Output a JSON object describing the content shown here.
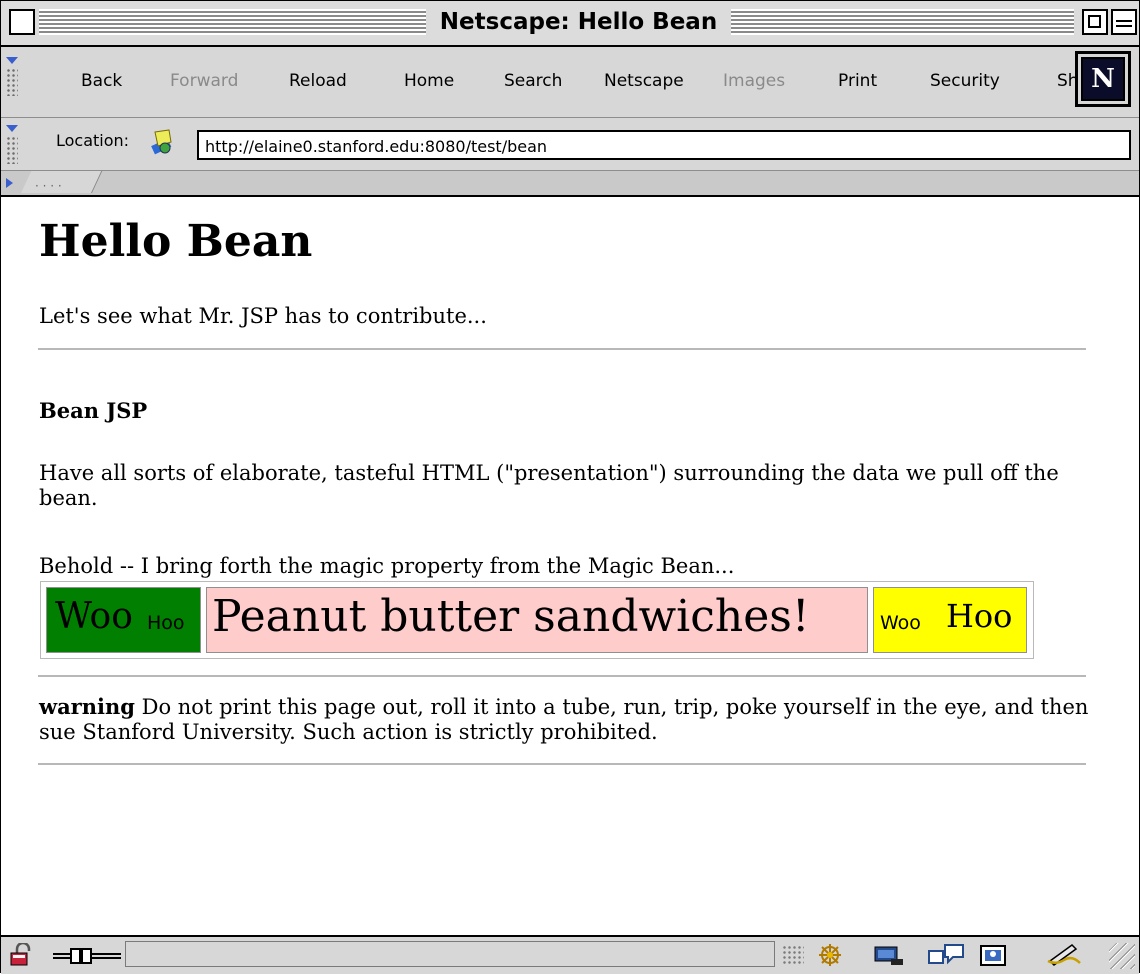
{
  "window": {
    "title": "Netscape: Hello Bean"
  },
  "toolbar": {
    "buttons": [
      {
        "label": "Back",
        "enabled": true
      },
      {
        "label": "Forward",
        "enabled": false
      },
      {
        "label": "Reload",
        "enabled": true
      },
      {
        "label": "Home",
        "enabled": true
      },
      {
        "label": "Search",
        "enabled": true
      },
      {
        "label": "Netscape",
        "enabled": true
      },
      {
        "label": "Images",
        "enabled": false
      },
      {
        "label": "Print",
        "enabled": true
      },
      {
        "label": "Security",
        "enabled": true
      },
      {
        "label": "Sh",
        "enabled": true
      }
    ],
    "logo_letter": "N"
  },
  "location": {
    "label": "Location:",
    "url": "http://elaine0.stanford.edu:8080/test/bean"
  },
  "page": {
    "heading": "Hello Bean",
    "intro": "Let's see what Mr. JSP has to contribute...",
    "subheading": "Bean JSP",
    "description": "Have all sorts of elaborate, tasteful HTML (\"presentation\") surrounding the data we pull off the bean.",
    "behold": "Behold -- I bring forth the magic property from the Magic Bean...",
    "magic_row": {
      "left": {
        "big": "Woo",
        "small": "Hoo",
        "color": "#007f00"
      },
      "middle": {
        "text": "Peanut butter sandwiches!",
        "color": "#ffcccc"
      },
      "right": {
        "small": "Woo",
        "big": "Hoo",
        "color": "#ffff00"
      }
    },
    "warning_label": "warning",
    "warning_text": " Do not print this page out, roll it into a tube, run, trip, poke yourself in the eye, and then sue Stanford University. Such action is strictly prohibited."
  },
  "statusbar": {
    "text": "",
    "icons": [
      "security-lock-icon",
      "connection-icon",
      "navigator-icon",
      "mail-icon",
      "newsgroups-icon",
      "address-book-icon",
      "composer-icon"
    ]
  }
}
